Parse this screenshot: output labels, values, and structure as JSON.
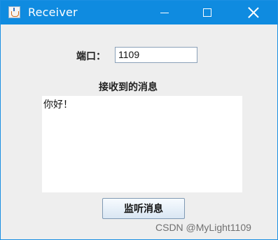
{
  "window": {
    "title": "Receiver",
    "icon": "java-cup-icon",
    "controls": {
      "minimize_icon": "minimize-icon",
      "maximize_icon": "maximize-icon",
      "close_icon": "close-icon"
    },
    "title_bar_color": "#0f8be0"
  },
  "form": {
    "port_label": "端口：",
    "port_value": "1109",
    "received_label": "接收到的消息",
    "message_text": "你好！",
    "listen_button_label": "监听消息"
  },
  "watermark": "CSDN @MyLight1109"
}
